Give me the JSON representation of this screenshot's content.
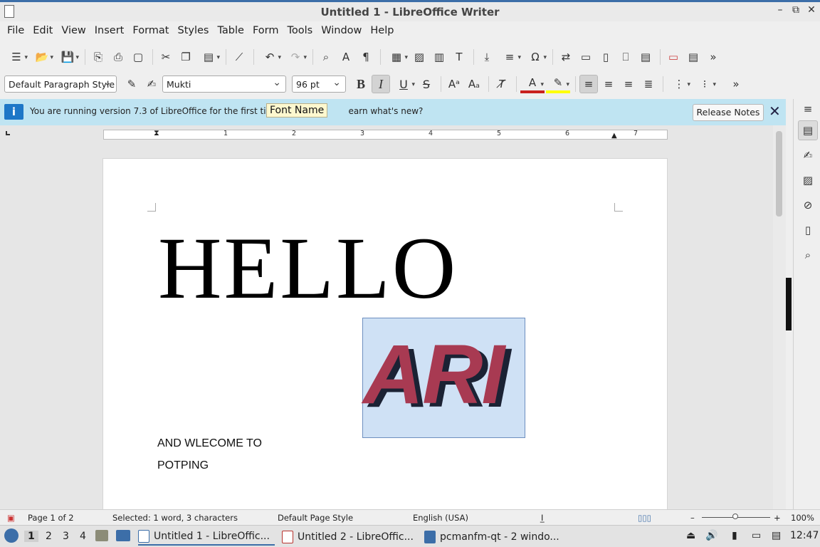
{
  "window": {
    "title": "Untitled 1 - LibreOffice Writer",
    "minimize": "–",
    "restore": "⧉",
    "close": "✕"
  },
  "menubar": [
    "File",
    "Edit",
    "View",
    "Insert",
    "Format",
    "Styles",
    "Table",
    "Form",
    "Tools",
    "Window",
    "Help"
  ],
  "format_toolbar": {
    "paragraph_style": "Default Paragraph Style",
    "font_name": "Mukti",
    "font_size": "96 pt",
    "bold": "B",
    "italic": "I",
    "underline": "U",
    "strike": "S"
  },
  "infobar": {
    "text_before": "You are running version 7.3 of LibreOffice for the first time. D",
    "text_after": "earn what's new?",
    "tooltip": "Font Name",
    "release_notes_label": "Release Notes",
    "close_glyph": "✕",
    "info_glyph": "i"
  },
  "ruler": {
    "marks": [
      "1",
      "2",
      "3",
      "4",
      "5",
      "6",
      "7"
    ]
  },
  "document": {
    "heading": "HELLO",
    "fontwork": "ARI",
    "line1": "AND WLECOME TO",
    "line2": "POTPING"
  },
  "statusbar": {
    "page": "Page 1 of 2",
    "selection": "Selected: 1 word, 3 characters",
    "page_style": "Default Page Style",
    "language": "English (USA)",
    "zoom_minus": "–",
    "zoom_plus": "+",
    "zoom": "100%"
  },
  "taskbar": {
    "workspaces": [
      "1",
      "2",
      "3",
      "4"
    ],
    "tasks": [
      "Untitled 1 - LibreOffic...",
      "Untitled 2 - LibreOffic...",
      "pcmanfm-qt - 2 windo..."
    ],
    "clock": "12:47"
  },
  "colors": {
    "accent": "#3c6ea8",
    "infobar": "#bfe4f2",
    "selection": "#cfe1f5",
    "fontwork_fill": "#a83a52",
    "fontwork_shadow": "#1b2234"
  }
}
